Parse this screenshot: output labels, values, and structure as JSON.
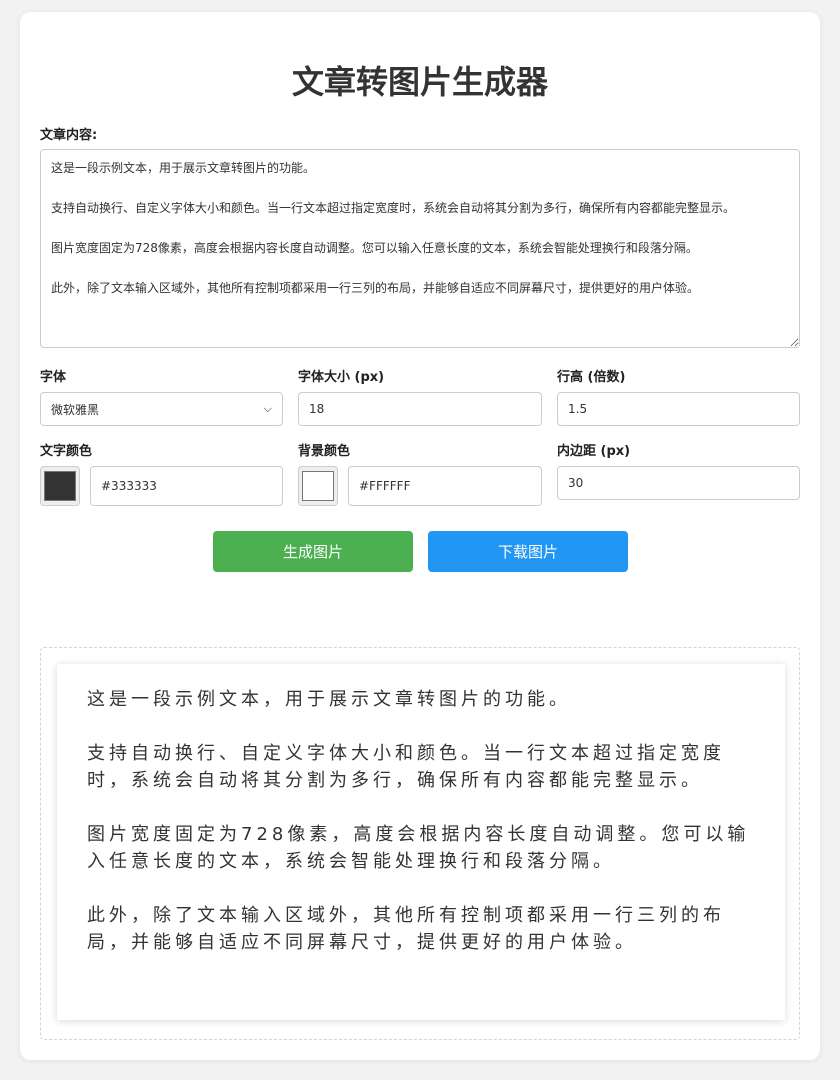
{
  "title": "文章转图片生成器",
  "article": {
    "label": "文章内容:",
    "value": "这是一段示例文本，用于展示文章转图片的功能。\n\n支持自动换行、自定义字体大小和颜色。当一行文本超过指定宽度时，系统会自动将其分割为多行，确保所有内容都能完整显示。\n\n图片宽度固定为728像素，高度会根据内容长度自动调整。您可以输入任意长度的文本，系统会智能处理换行和段落分隔。\n\n此外，除了文本输入区域外，其他所有控制项都采用一行三列的布局，并能够自适应不同屏幕尺寸，提供更好的用户体验。"
  },
  "controls": {
    "font": {
      "label": "字体",
      "value": "微软雅黑"
    },
    "font_size": {
      "label": "字体大小 (px)",
      "value": "18"
    },
    "line_height": {
      "label": "行高 (倍数)",
      "value": "1.5"
    },
    "text_color": {
      "label": "文字颜色",
      "value": "#333333",
      "color": "#333333"
    },
    "bg_color": {
      "label": "背景颜色",
      "value": "#FFFFFF",
      "color": "#FFFFFF"
    },
    "padding": {
      "label": "内边距 (px)",
      "value": "30"
    }
  },
  "buttons": {
    "generate": "生成图片",
    "download": "下载图片",
    "generate_color": "#4caf50",
    "download_color": "#2196f3"
  },
  "preview": {
    "paragraphs": [
      "这是一段示例文本，用于展示文章转图片的功能。",
      "支持自动换行、自定义字体大小和颜色。当一行文本超过指定宽度时，系统会自动将其分割为多行，确保所有内容都能完整显示。",
      "图片宽度固定为728像素，高度会根据内容长度自动调整。您可以输入任意长度的文本，系统会智能处理换行和段落分隔。",
      "此外，除了文本输入区域外，其他所有控制项都采用一行三列的布局，并能够自适应不同屏幕尺寸，提供更好的用户体验。"
    ]
  }
}
